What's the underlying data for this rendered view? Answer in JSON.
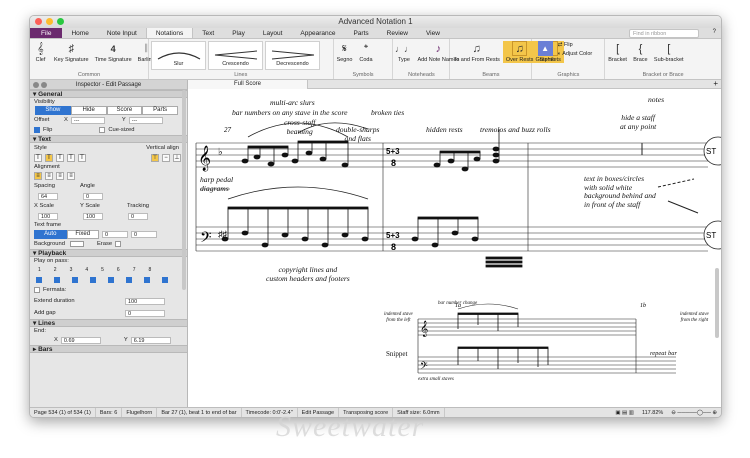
{
  "window": {
    "title": "Advanced Notation 1"
  },
  "tabs": [
    "File",
    "Home",
    "Note Input",
    "Notations",
    "Text",
    "Play",
    "Layout",
    "Appearance",
    "Parts",
    "Review",
    "View"
  ],
  "find_placeholder": "Find in ribbon",
  "ribbon": {
    "common": {
      "label": "Common",
      "items": [
        "Clef",
        "Key Signature",
        "Time Signature",
        "Barline"
      ]
    },
    "lines": {
      "label": "Lines",
      "items": [
        "Slur",
        "Crescendo",
        "Decrescendo"
      ]
    },
    "symbols": {
      "label": "Symbols",
      "items": [
        "Segno",
        "Coda"
      ]
    },
    "noteheads": {
      "label": "Noteheads",
      "items": [
        "Type",
        "Add Note Names"
      ]
    },
    "beams": {
      "label": "Beams",
      "items": [
        "To and From Rests",
        "Over Rests",
        "Stemlets"
      ]
    },
    "graphics": {
      "label": "Graphics",
      "items": [
        "Graphic",
        "Flip",
        "Adjust Color"
      ]
    },
    "bracket": {
      "label": "Bracket or Brace",
      "items": [
        "Bracket",
        "Brace",
        "Sub-bracket"
      ]
    }
  },
  "inspector": {
    "title": "Inspector - Edit Passage",
    "general": "General",
    "visibility": "Visibility",
    "vis_opts": [
      "Show",
      "Hide",
      "Score",
      "Parts"
    ],
    "offset": "Offset",
    "x": "X",
    "y": "Y",
    "x_val": "---",
    "y_val": "---",
    "flip": "Flip",
    "cue": "Cue-sized",
    "text": "Text",
    "style": "Style",
    "valign": "Vertical align",
    "alignment": "Alignment",
    "spacing": "Spacing",
    "angle": "Angle",
    "spacing_val": "64",
    "angle_val": "0",
    "xscale": "X Scale",
    "yscale": "Y Scale",
    "tracking": "Tracking",
    "xscale_val": "100",
    "yscale_val": "100",
    "tracking_val": "0",
    "textframe": "Text frame",
    "tf_opts": [
      "Auto",
      "Fixed"
    ],
    "tf_a": "0",
    "tf_b": "0",
    "background": "Background",
    "erase": "Erase",
    "playback": "Playback",
    "play_on_pass": "Play on pass:",
    "passes": [
      "1",
      "2",
      "3",
      "4",
      "5",
      "6",
      "7",
      "8"
    ],
    "fermata": "Fermata:",
    "extend": "Extend duration",
    "extend_val": "100",
    "addgap": "Add gap",
    "addgap_val": "0",
    "lines": "Lines",
    "end": "End:",
    "end_x": "0.69",
    "end_y": "6.19",
    "bars": "Bars"
  },
  "score": {
    "tab": "Full Score",
    "annotations": {
      "multi_arc": "multi-arc slurs",
      "bar_numbers": "bar numbers on any stave in the score",
      "broken_ties": "broken ties",
      "notes": "notes",
      "hide_staff": "hide a staff\nat any point",
      "cross_staff": "cross-staff\nbeaming",
      "double_sharps": "double-sharps\nand flats",
      "hidden_rests": "hidden rests",
      "tremolos": "tremolos and buzz rolls",
      "harp": "harp pedal\ndiagrams",
      "text_boxes": "text in boxes/circles\nwith solid white\nbackground behind and\nin front of the staff",
      "copyright": "copyright lines and\ncustom headers and footers",
      "indented_left": "indented stave\nfrom the left",
      "bar_num_change": "bar number change",
      "indented_right": "indented stave\nfrom the right",
      "snippet": "Snippet",
      "repeat_bar": "repeat bar",
      "extra_small": "extra small staves"
    },
    "bar_number": "27",
    "st": "ST",
    "snippet_bars": [
      "1a",
      "1b"
    ],
    "time_sig": "5+3/8"
  },
  "status": [
    "Page 534 (1) of 534 (1)",
    "Bars: 6",
    "Flugelhorn",
    "Bar 27 (1), beat 1 to end of bar",
    "Timecode: 0:0'-2.4\"",
    "Edit Passage",
    "Transposing score",
    "Staff size: 6.0mm"
  ],
  "zoom": "117.82%",
  "watermark": "Sweetwater"
}
